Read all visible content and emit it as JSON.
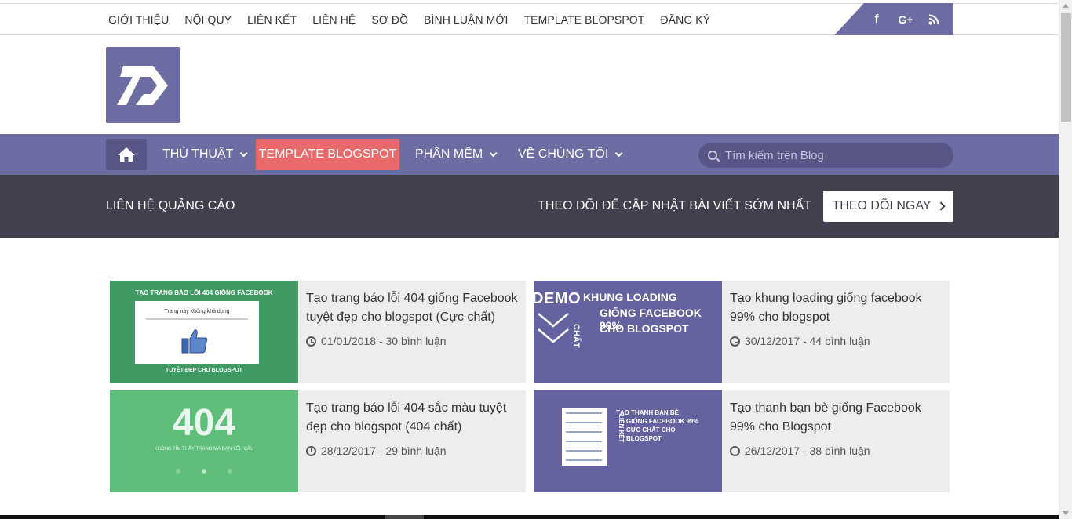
{
  "topnav": [
    "GIỚI THIỆU",
    "NỘI QUY",
    "LIÊN KẾT",
    "LIÊN HỆ",
    "SƠ ĐỒ",
    "BÌNH LUẬN MỚI",
    "TEMPLATE BLOPSPOT",
    "ĐĂNG KÝ"
  ],
  "social": [
    "facebook-icon",
    "google-plus-icon",
    "rss-icon"
  ],
  "mainnav": {
    "item1": "THỦ THUẬT",
    "item2": "TEMPLATE BLOGSPOT",
    "item3": "PHẦN MỀM",
    "item4": "VỀ CHÚNG TÔI",
    "search_placeholder": "Tìm kiếm trên Blog"
  },
  "followbar": {
    "ad_contact": "LIÊN HỆ QUẢNG CÁO",
    "follow_text": "THEO DÕI ĐỂ CẬP NHẬT BÀI VIẾT SỚM NHẤT",
    "follow_button": "THEO DÕI NGAY"
  },
  "posts": [
    {
      "title": "Tạo trang báo lỗi 404 giống Facebook tuyệt đẹp cho blogspot (Cực chất)",
      "meta": "01/01/2018 - 30 bình luận",
      "thumb_top": "TẠO TRANG BÁO LỖI 404 GIỐNG FACEBOOK",
      "thumb_mid": "Trang này không khả dụng",
      "thumb_bottom": "TUYỆT ĐẸP CHO BLOGSPOT"
    },
    {
      "title": "Tạo khung loading giống facebook 99% cho blogspot",
      "meta": "30/12/2017 - 44 bình luận",
      "thumb_demo": "DEMO",
      "thumb_l1": "KHUNG LOADING",
      "thumb_l2": "GIỐNG FACEBOOK 99%",
      "thumb_l3": "CHO BLOGSPOT",
      "thumb_side": "CHẤT"
    },
    {
      "title": "Tạo trang báo lỗi 404 sắc màu tuyệt đẹp cho blogspot (404 chất)",
      "meta": "28/12/2017 - 29 bình luận",
      "thumb_big": "404",
      "thumb_small": "KHÔNG TÌM THẤY TRANG MÀ BẠN YÊU CẦU"
    },
    {
      "title": "Tạo thanh bạn bè giống Facebook 99% cho Blogspot",
      "meta": "26/12/2017 - 38 bình luận",
      "thumb_l1": "TẠO THANH BẠN BÈ",
      "thumb_l2": "GIỐNG FACEBOOK 99%",
      "thumb_l3": "CỰC CHẤT CHO",
      "thumb_l4": "BLOGSPOT",
      "thumb_side": "LIÊN KẾT"
    }
  ],
  "colors": {
    "brand": "#6d6ca3",
    "brand_dark": "#575686",
    "accent": "#e96a6a",
    "followbar": "#41404f",
    "card": "#ededed"
  }
}
